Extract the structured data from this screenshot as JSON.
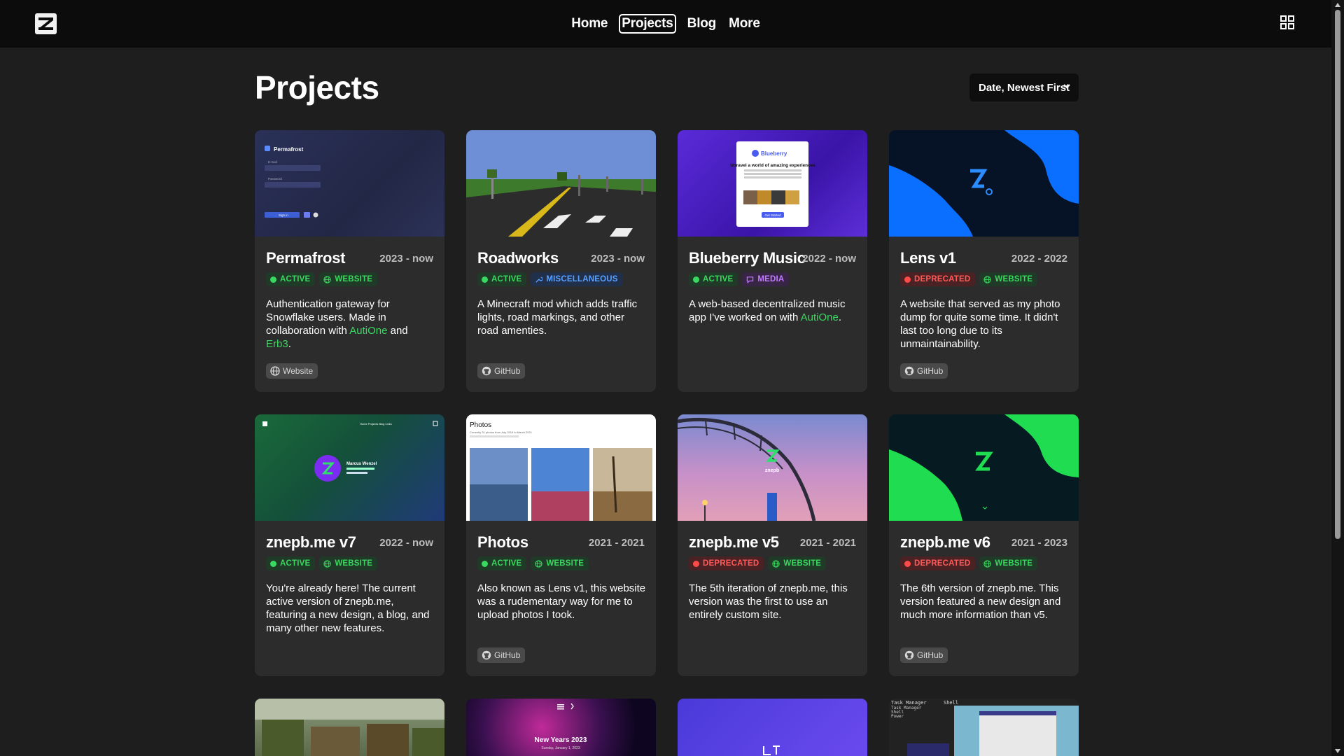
{
  "nav": {
    "items": [
      {
        "label": "Home",
        "active": false
      },
      {
        "label": "Projects",
        "active": true
      },
      {
        "label": "Blog",
        "active": false
      },
      {
        "label": "More",
        "active": false
      }
    ],
    "logo_icon": "z-logo-icon",
    "menu_icon": "grid-icon"
  },
  "page": {
    "title": "Projects",
    "sort_label": "Date, Newest First"
  },
  "colors": {
    "background": "#1e1e1e",
    "card": "#2c2c2c",
    "accent_green": "#3ad860",
    "deprecated_red": "#ff5a5a",
    "misc_blue": "#5aa0ff",
    "media_purple": "#c07cff"
  },
  "projects": [
    {
      "title": "Permafrost",
      "years": "2023 - now",
      "status": "ACTIVE",
      "type": "WEBSITE",
      "desc_parts": [
        "Authentication gateway for Snowflake users. Made in collaboration with ",
        "AutiOne",
        " and ",
        "Erb3",
        "."
      ],
      "button": "Website"
    },
    {
      "title": "Roadworks",
      "years": "2023 - now",
      "status": "ACTIVE",
      "type": "MISCELLANEOUS",
      "desc_parts": [
        "A Minecraft mod which adds traffic lights, road markings, and other road amenties."
      ],
      "button": "GitHub"
    },
    {
      "title": "Blueberry Music",
      "years": "2022 - now",
      "status": "ACTIVE",
      "type": "MEDIA",
      "desc_parts": [
        "A web-based decentralized music app I've worked on with ",
        "AutiOne",
        "."
      ],
      "button": ""
    },
    {
      "title": "Lens v1",
      "years": "2022 - 2022",
      "status": "DEPRECATED",
      "type": "WEBSITE",
      "desc_parts": [
        "A website that served as my photo dump for quite some time. It didn't last too long due to its unmaintainability."
      ],
      "button": "GitHub"
    },
    {
      "title": "znepb.me v7",
      "years": "2022 - now",
      "status": "ACTIVE",
      "type": "WEBSITE",
      "desc_parts": [
        "You're already here! The current active version of znepb.me, featuring a new design, a blog, and many other new features."
      ],
      "button": ""
    },
    {
      "title": "Photos",
      "years": "2021 - 2021",
      "status": "ACTIVE",
      "type": "WEBSITE",
      "desc_parts": [
        "Also known as Lens v1, this website was a rudementary way for me to upload photos I took."
      ],
      "button": "GitHub"
    },
    {
      "title": "znepb.me v5",
      "years": "2021 - 2021",
      "status": "DEPRECATED",
      "type": "WEBSITE",
      "desc_parts": [
        "The 5th iteration of znepb.me, this version was the first to use an entirely custom site."
      ],
      "button": ""
    },
    {
      "title": "znepb.me v6",
      "years": "2021 - 2023",
      "status": "DEPRECATED",
      "type": "WEBSITE",
      "desc_parts": [
        "The 6th version of znepb.me. This version featured a new design and much more information than v5."
      ],
      "button": "GitHub"
    }
  ],
  "thumb_text": {
    "permafrost_brand": "Permafrost",
    "permafrost_email": "E-mail",
    "permafrost_password": "Password",
    "permafrost_signin": "Sign in",
    "blueberry_brand": "Blueberry",
    "blueberry_headline": "Unravel a world of amazing experiences",
    "blueberry_cta": "Get Started",
    "v7_name": "Marcus Wenzel",
    "v7_nav": "Home  Projects  Blog  Links",
    "photos_title": "Photos",
    "photos_sub": "Currently 31 photos from July 2019 to March 2021",
    "v5_label": "znepb",
    "newyears_title": "New Years 2023",
    "newyears_date": "Sunday, January 1, 2023",
    "tm_title": "Task Manager",
    "tm_shell": "Shell",
    "tm_menu_1": "Task Manager",
    "tm_menu_2": "Shell",
    "tm_menu_3": "Power"
  }
}
